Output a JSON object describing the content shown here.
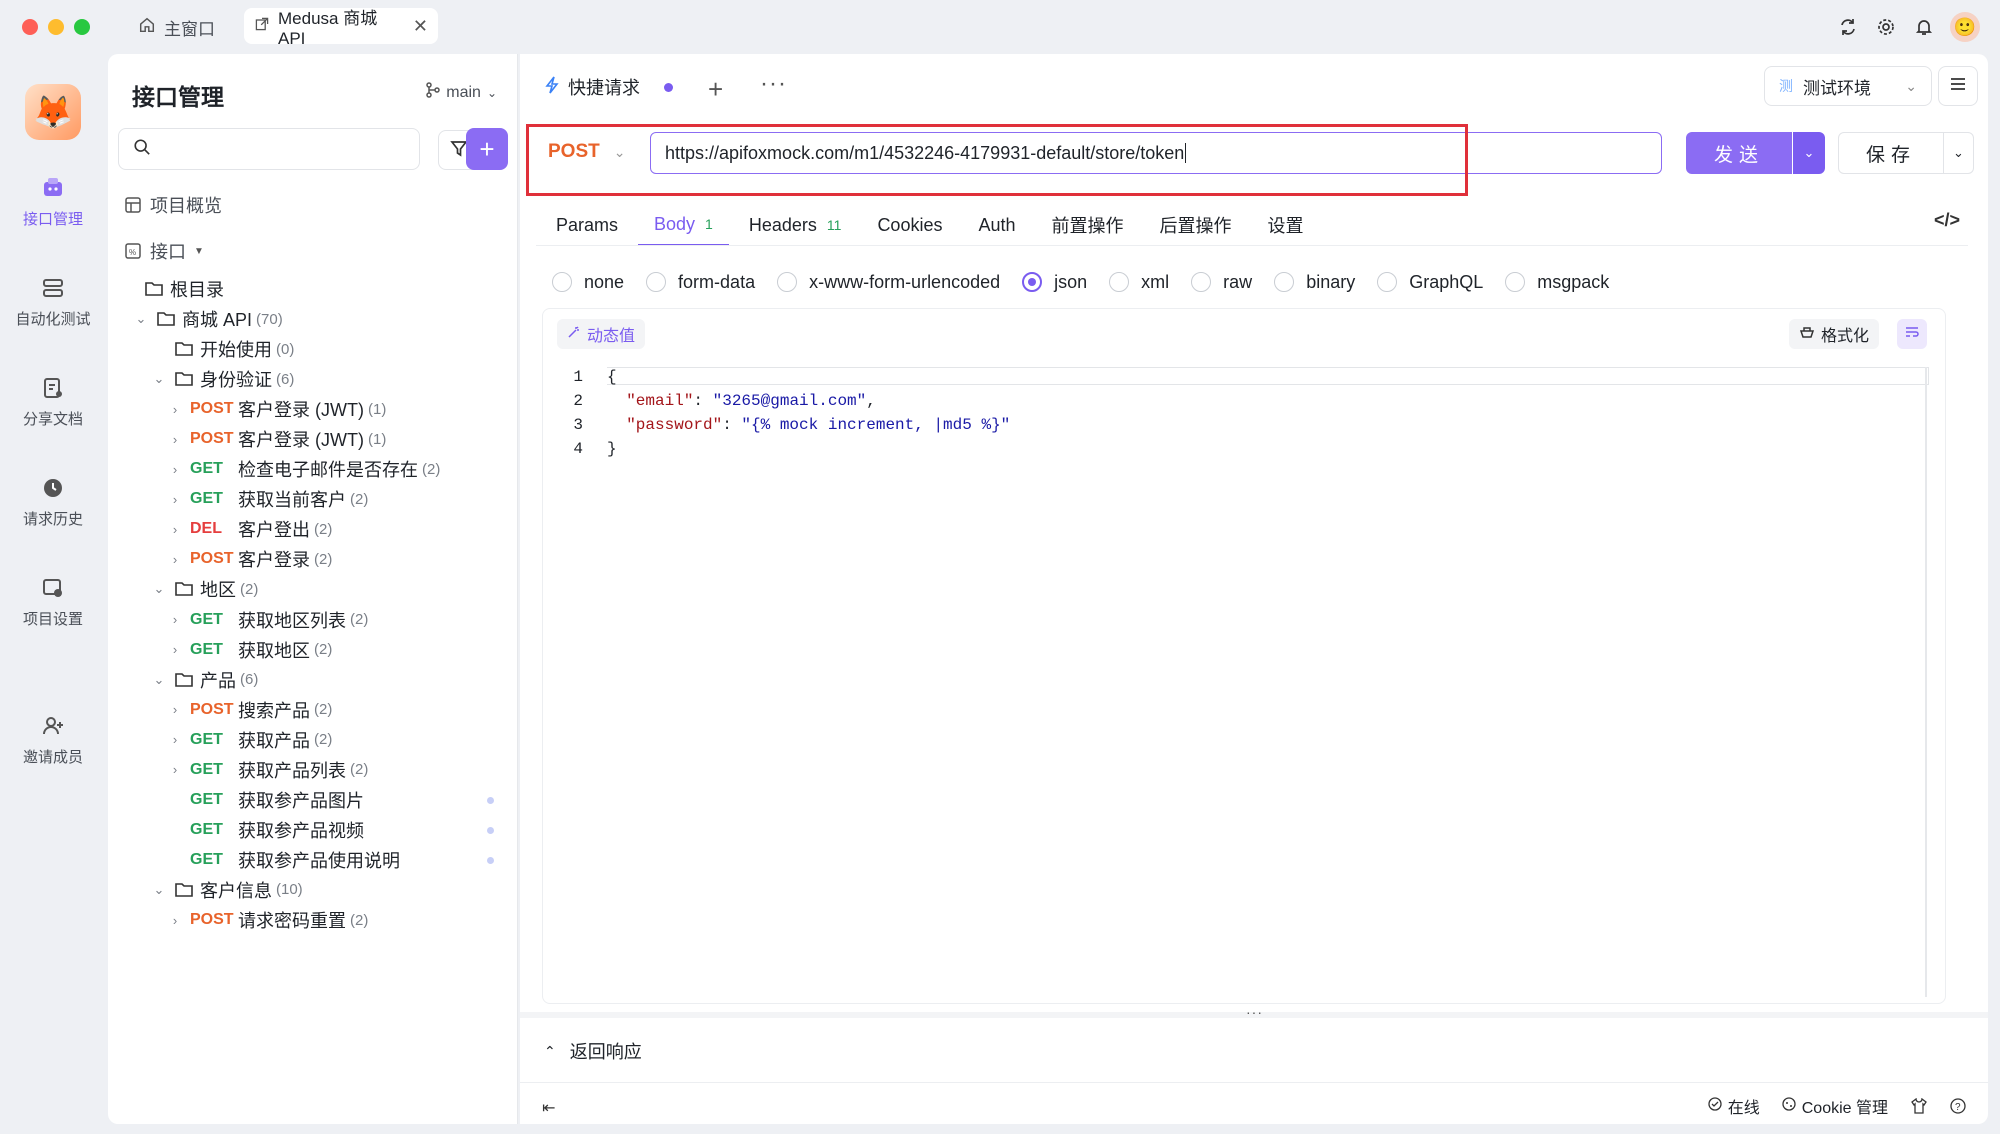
{
  "titlebar": {
    "home_tab": "主窗口",
    "doc_tab": "Medusa 商城 API"
  },
  "rail": [
    {
      "label": "接口管理",
      "icon": "api-management-icon",
      "active": true
    },
    {
      "label": "自动化测试",
      "icon": "automation-test-icon"
    },
    {
      "label": "分享文档",
      "icon": "share-doc-icon"
    },
    {
      "label": "请求历史",
      "icon": "history-icon"
    },
    {
      "label": "项目设置",
      "icon": "project-settings-icon"
    },
    {
      "label": "邀请成员",
      "icon": "invite-member-icon"
    }
  ],
  "sidebar": {
    "title": "接口管理",
    "branch": "main",
    "search_placeholder": "",
    "overview": "项目概览",
    "interfaces": "接口",
    "root": "根目录"
  },
  "tree": [
    {
      "kind": "folder",
      "label": "商城 API",
      "count": "(70)",
      "depth": 1,
      "open": true
    },
    {
      "kind": "folder",
      "label": "开始使用",
      "count": "(0)",
      "depth": 2,
      "open": null
    },
    {
      "kind": "folder",
      "label": "身份验证",
      "count": "(6)",
      "depth": 2,
      "open": true
    },
    {
      "kind": "api",
      "method": "POST",
      "label": "客户登录 (JWT)",
      "count": "(1)",
      "depth": 3
    },
    {
      "kind": "api",
      "method": "POST",
      "label": "客户登录 (JWT)",
      "count": "(1)",
      "depth": 3
    },
    {
      "kind": "api",
      "method": "GET",
      "label": "检查电子邮件是否存在",
      "count": "(2)",
      "depth": 3
    },
    {
      "kind": "api",
      "method": "GET",
      "label": "获取当前客户",
      "count": "(2)",
      "depth": 3
    },
    {
      "kind": "api",
      "method": "DEL",
      "label": "客户登出",
      "count": "(2)",
      "depth": 3
    },
    {
      "kind": "api",
      "method": "POST",
      "label": "客户登录",
      "count": "(2)",
      "depth": 3
    },
    {
      "kind": "folder",
      "label": "地区",
      "count": "(2)",
      "depth": 2,
      "open": true
    },
    {
      "kind": "api",
      "method": "GET",
      "label": "获取地区列表",
      "count": "(2)",
      "depth": 3
    },
    {
      "kind": "api",
      "method": "GET",
      "label": "获取地区",
      "count": "(2)",
      "depth": 3
    },
    {
      "kind": "folder",
      "label": "产品",
      "count": "(6)",
      "depth": 2,
      "open": true
    },
    {
      "kind": "api",
      "method": "POST",
      "label": "搜索产品",
      "count": "(2)",
      "depth": 3
    },
    {
      "kind": "api",
      "method": "GET",
      "label": "获取产品",
      "count": "(2)",
      "depth": 3
    },
    {
      "kind": "api",
      "method": "GET",
      "label": "获取产品列表",
      "count": "(2)",
      "depth": 3
    },
    {
      "kind": "api",
      "method": "GET",
      "label": "获取参产品图片",
      "count": "",
      "depth": 3,
      "leaf": true
    },
    {
      "kind": "api",
      "method": "GET",
      "label": "获取参产品视频",
      "count": "",
      "depth": 3,
      "leaf": true
    },
    {
      "kind": "api",
      "method": "GET",
      "label": "获取参产品使用说明",
      "count": "",
      "depth": 3,
      "leaf": true
    },
    {
      "kind": "folder",
      "label": "客户信息",
      "count": "(10)",
      "depth": 2,
      "open": true
    },
    {
      "kind": "api",
      "method": "POST",
      "label": "请求密码重置",
      "count": "(2)",
      "depth": 3
    }
  ],
  "main": {
    "tab_label": "快捷请求",
    "environment": "测试环境",
    "env_badge": "测",
    "method": "POST",
    "url": "https://apifoxmock.com/m1/4532246-4179931-default/store/token",
    "send_label": "发送",
    "save_label": "保存",
    "subtabs": [
      {
        "label": "Params",
        "count": ""
      },
      {
        "label": "Body",
        "count": "1",
        "active": true
      },
      {
        "label": "Headers",
        "count": "11"
      },
      {
        "label": "Cookies",
        "count": ""
      },
      {
        "label": "Auth",
        "count": ""
      },
      {
        "label": "前置操作",
        "count": ""
      },
      {
        "label": "后置操作",
        "count": ""
      },
      {
        "label": "设置",
        "count": ""
      }
    ],
    "body_types": [
      "none",
      "form-data",
      "x-www-form-urlencoded",
      "json",
      "xml",
      "raw",
      "binary",
      "GraphQL",
      "msgpack"
    ],
    "body_type_selected": "json",
    "dynamic_value": "动态值",
    "format_label": "格式化",
    "code": {
      "line1": "{",
      "email_key": "\"email\"",
      "email_val": "\"3265@gmail.com\"",
      "password_key": "\"password\"",
      "password_val": "\"{% mock increment, |md5 %}\"",
      "line4": "}"
    },
    "response_label": "返回响应",
    "footer": {
      "online": "在线",
      "cookie": "Cookie 管理"
    }
  }
}
